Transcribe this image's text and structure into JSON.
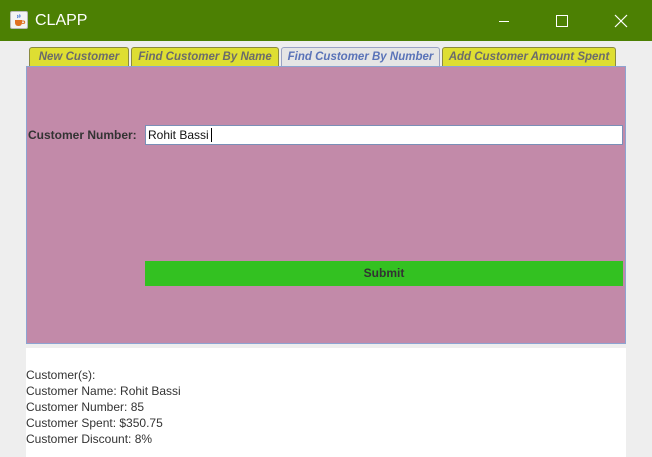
{
  "window": {
    "title": "CLAPP",
    "app_icon": "java-coffee-icon",
    "controls": [
      "minimize-icon",
      "maximize-icon",
      "close-icon"
    ],
    "titlebar_color": "#4c8003"
  },
  "tabs": [
    {
      "label": "New Customer",
      "active": false
    },
    {
      "label": "Find Customer By Name",
      "active": false
    },
    {
      "label": "Find Customer By Number",
      "active": true
    },
    {
      "label": "Add Customer Amount Spent",
      "active": false
    }
  ],
  "form": {
    "customer_number_label": "Customer Number:",
    "customer_number_value": "Rohit Bassi",
    "submit_label": "Submit",
    "panel_color": "#c28aa9",
    "submit_color": "#33c121"
  },
  "output": {
    "lines": [
      "Customer(s):",
      "Customer Name: Rohit Bassi",
      "Customer Number: 85",
      "Customer Spent: $350.75",
      "Customer Discount: 8%"
    ]
  }
}
